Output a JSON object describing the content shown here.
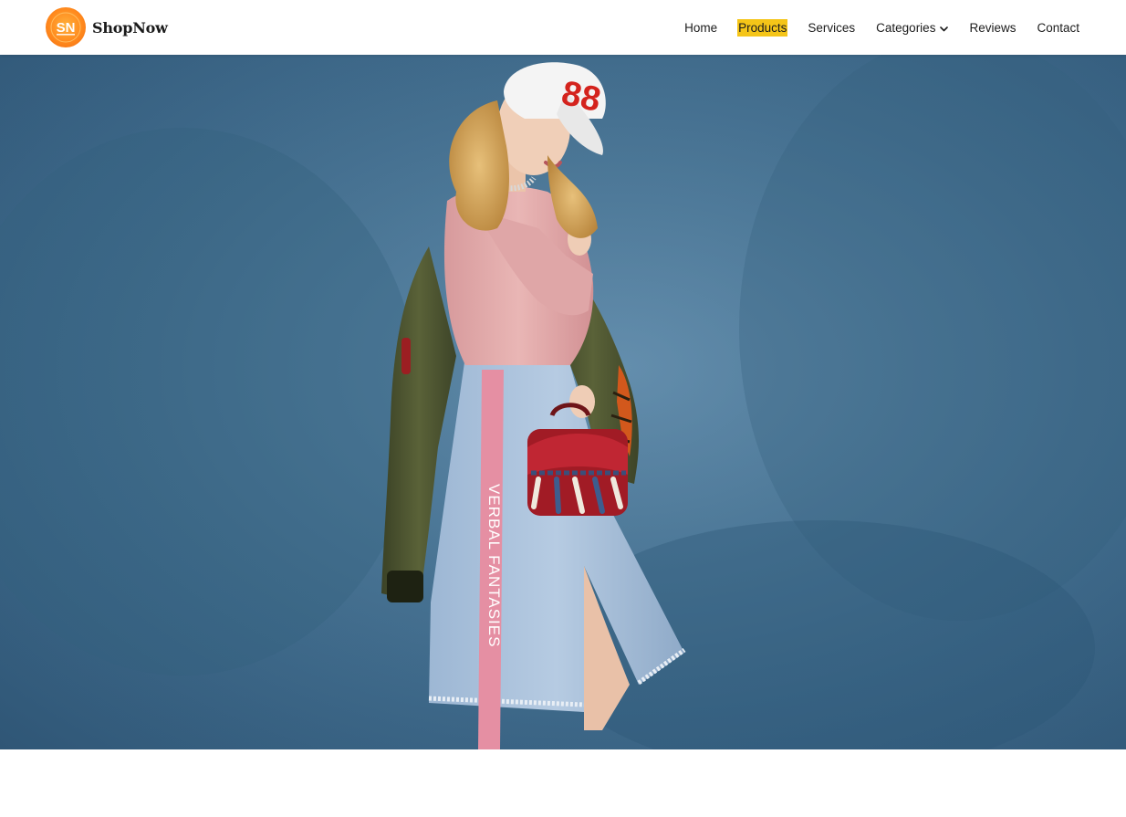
{
  "brand": {
    "logo_text": "SN",
    "name": "ShopNow",
    "logo_color": "#ff8a1e"
  },
  "nav": {
    "items": [
      {
        "label": "Home"
      },
      {
        "label": "Products",
        "active": true
      },
      {
        "label": "Services"
      },
      {
        "label": "Categories",
        "icon": "chevron-down-icon"
      },
      {
        "label": "Reviews"
      },
      {
        "label": "Contact"
      }
    ],
    "active_highlight_color": "#f5c518"
  },
  "hero": {
    "background_color": "#4a7797",
    "cap_text": "88",
    "skirt_stripe_text": "VERBAL FANTASIES"
  }
}
